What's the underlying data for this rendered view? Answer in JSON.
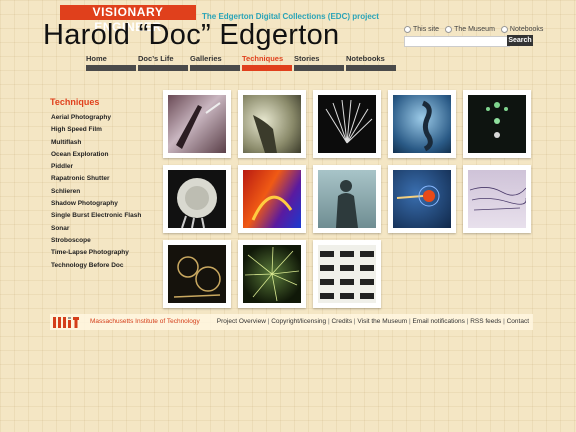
{
  "header": {
    "banner": "VISIONARY ENGINEER",
    "subtitle": "The Edgerton Digital Collections (EDC) project",
    "title": "Harold “Doc” Edgerton"
  },
  "search": {
    "scopes": [
      "This site",
      "The Museum",
      "Notebooks"
    ],
    "button": "Search",
    "value": ""
  },
  "nav": [
    {
      "label": "Home",
      "active": false
    },
    {
      "label": "Doc’s Life",
      "active": false
    },
    {
      "label": "Galleries",
      "active": false
    },
    {
      "label": "Techniques",
      "active": true
    },
    {
      "label": "Stories",
      "active": false
    },
    {
      "label": "Notebooks",
      "active": false
    }
  ],
  "sidebar": {
    "heading": "Techniques",
    "items": [
      "Aerial Photography",
      "High Speed Film",
      "Multiflash",
      "Ocean Exploration",
      "Piddler",
      "Rapatronic Shutter",
      "Schlieren",
      "Shadow Photography",
      "Single Burst Electronic Flash",
      "Sonar",
      "Stroboscope",
      "Time-Lapse Photography",
      "Technology Before Doc"
    ]
  },
  "gallery": {
    "thumbs": [
      {
        "name": "thumb-aerial-photo"
      },
      {
        "name": "thumb-high-speed-film"
      },
      {
        "name": "thumb-multiflash"
      },
      {
        "name": "thumb-ocean-seahorse"
      },
      {
        "name": "thumb-piddler-drops"
      },
      {
        "name": "thumb-rapatronic-fireball"
      },
      {
        "name": "thumb-schlieren-color"
      },
      {
        "name": "thumb-shadow-figure"
      },
      {
        "name": "thumb-single-burst-flash"
      },
      {
        "name": "thumb-sonar-chart"
      },
      {
        "name": "thumb-stroboscope"
      },
      {
        "name": "thumb-time-lapse-fireworks"
      },
      {
        "name": "thumb-horse-sequence"
      }
    ]
  },
  "footer": {
    "institution": "Massachusetts Institute of Technology",
    "links": [
      "Project Overview",
      "Copyright/licensing",
      "Credits",
      "Visit the Museum",
      "Email notifications",
      "RSS feeds",
      "Contact"
    ]
  },
  "colors": {
    "accent": "#e0401c",
    "subtitle": "#2aa4b8",
    "nav_bar": "#4a4a4a"
  }
}
